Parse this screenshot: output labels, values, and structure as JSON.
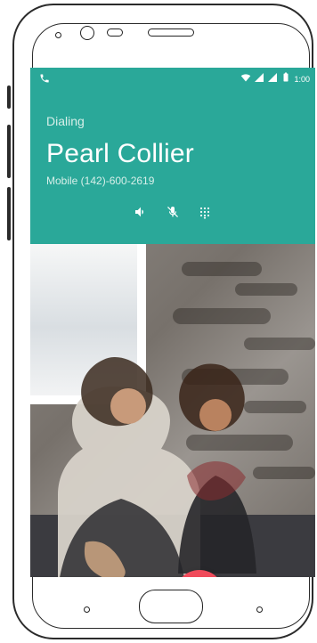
{
  "status_bar": {
    "time": "1:00",
    "icons": [
      "phone-icon",
      "wifi-icon",
      "signal-icon",
      "battery-icon"
    ]
  },
  "call": {
    "state": "Dialing",
    "name": "Pearl Collier",
    "number": "Mobile (142)-600-2619"
  },
  "actions": [
    {
      "id": "speaker",
      "icon": "speaker-icon"
    },
    {
      "id": "mute",
      "icon": "mute-icon"
    },
    {
      "id": "keypad",
      "icon": "dialpad-icon"
    }
  ],
  "colors": {
    "header_bg": "#2aa899",
    "end_call": "#f04b5b"
  }
}
